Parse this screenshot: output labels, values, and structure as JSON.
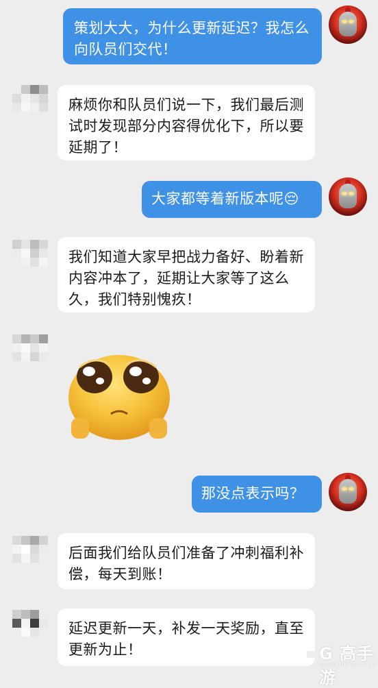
{
  "messages": [
    {
      "sender": "me",
      "text": "策划大大，为什么更新延迟？我怎么向队员们交代！"
    },
    {
      "sender": "them",
      "text": "麻烦你和队员们说一下，我们最后测试时发现部分内容得优化下，所以要延期了！"
    },
    {
      "sender": "me",
      "text": "大家都等着新版本呢😔"
    },
    {
      "sender": "them",
      "text": "我们知道大家早把战力备好、盼着新内容冲本了，延期让大家等了这么久，我们特别愧疚！"
    },
    {
      "sender": "them",
      "sticker": "crying-face-sticker"
    },
    {
      "sender": "me",
      "text": "那没点表示吗？"
    },
    {
      "sender": "them",
      "text": "后面我们给队员们准备了冲刺福利补偿，每天到账！"
    },
    {
      "sender": "them",
      "text": "延迟更新一天，补发一天奖励，直至更新为止！"
    }
  ],
  "watermark": {
    "brand": "G 高手游",
    "url": "GAOSHOUYOU.COM"
  },
  "colors": {
    "background": "#ededed",
    "my_bubble": "#3f91e6",
    "their_bubble": "#ffffff"
  }
}
